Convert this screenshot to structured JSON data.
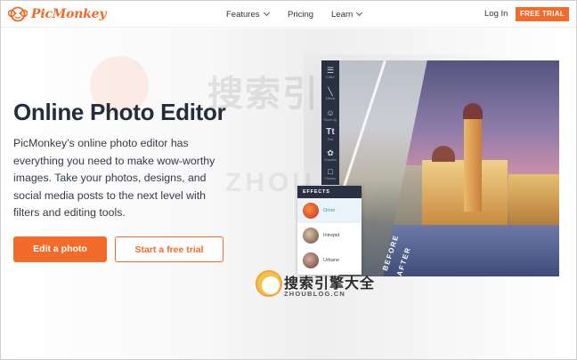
{
  "header": {
    "logo_text": "PicMonkey",
    "nav": [
      {
        "label": "Features",
        "has_menu": true
      },
      {
        "label": "Pricing",
        "has_menu": false
      },
      {
        "label": "Learn",
        "has_menu": true
      }
    ],
    "login_label": "Log In",
    "free_trial_label": "FREE TRIAL",
    "accent": "#f26b2a"
  },
  "hero": {
    "title": "Online Photo Editor",
    "description": "PicMonkey’s online photo editor has everything you need to make wow-worthy images. Take your photos, designs, and social media posts to the next level with filters and editing tools.",
    "primary_button": "Edit a photo",
    "secondary_button": "Start a free trial"
  },
  "editor": {
    "tools": [
      {
        "icon": "sliders-icon",
        "label": "Editor"
      },
      {
        "icon": "wand-icon",
        "label": "Effects"
      },
      {
        "icon": "face-icon",
        "label": "Touch Up"
      },
      {
        "icon": "text-icon",
        "glyph": "Tt",
        "label": "Text"
      },
      {
        "icon": "graphics-icon",
        "label": "Graphics"
      },
      {
        "icon": "frame-icon",
        "label": "Frames"
      }
    ],
    "effects_title": "EFFECTS",
    "effects": [
      {
        "name": "Orion",
        "selected": true
      },
      {
        "name": "Intrepid",
        "selected": false
      },
      {
        "name": "Urbane",
        "selected": false
      }
    ],
    "before_label": "BEFORE",
    "after_label": "AFTER"
  },
  "watermark": {
    "chinese": "搜索引擎大全",
    "url": "ZHOUBLOG.CN",
    "faint_word": "ZHOU"
  }
}
